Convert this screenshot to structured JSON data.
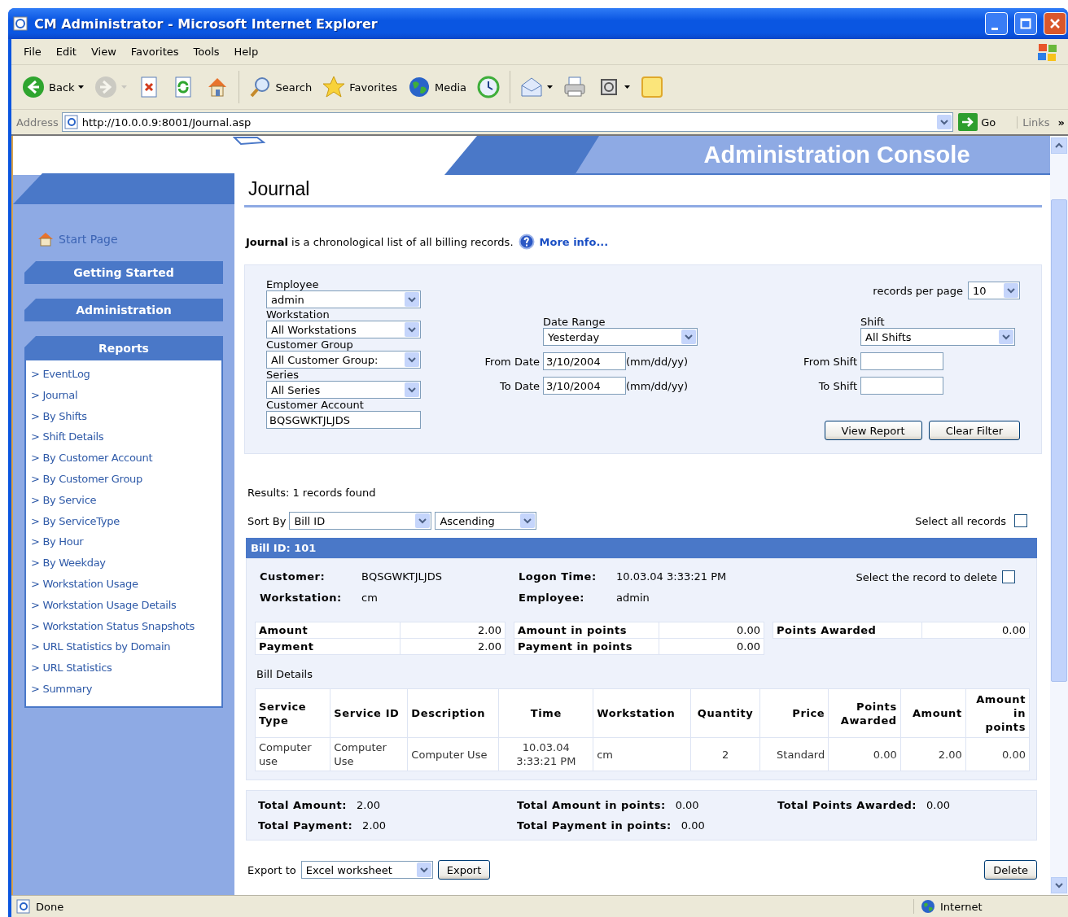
{
  "window": {
    "title": "CM Administrator - Microsoft Internet Explorer"
  },
  "menu": [
    "File",
    "Edit",
    "View",
    "Favorites",
    "Tools",
    "Help"
  ],
  "toolbar": [
    {
      "kind": "back",
      "label": "Back",
      "disabled": false,
      "has_menu": true
    },
    {
      "kind": "forward",
      "disabled": true,
      "has_menu": true
    },
    {
      "kind": "stop",
      "disabled": false,
      "has_menu": false
    },
    {
      "kind": "refresh",
      "disabled": false,
      "has_menu": false
    },
    {
      "kind": "home",
      "disabled": false,
      "has_menu": false
    },
    {
      "kind": "search",
      "label": "Search",
      "disabled": false,
      "has_menu": false
    },
    {
      "kind": "favorites",
      "label": "Favorites",
      "disabled": false,
      "has_menu": false
    },
    {
      "kind": "media",
      "label": "Media",
      "disabled": false,
      "has_menu": false
    },
    {
      "kind": "history",
      "disabled": false,
      "has_menu": false
    },
    {
      "kind": "mail",
      "disabled": false,
      "has_menu": true
    },
    {
      "kind": "print",
      "disabled": false,
      "has_menu": false
    },
    {
      "kind": "edit",
      "disabled": false,
      "has_menu": true
    },
    {
      "kind": "note",
      "disabled": false,
      "has_menu": false
    }
  ],
  "address": {
    "label": "Address",
    "url": "http://10.0.0.9:8001/Journal.asp",
    "go": "Go",
    "links": "Links",
    "more": "»"
  },
  "banner": {
    "title": "Administration Console"
  },
  "sidebar": {
    "start_page": "Start Page",
    "sections": [
      "Getting Started",
      "Administration"
    ],
    "reports": {
      "title": "Reports",
      "items": [
        "> EventLog",
        "> Journal",
        "> By Shifts",
        "> Shift Details",
        "> By Customer Account",
        "> By Customer Group",
        "> By Service",
        "> By ServiceType",
        "> By Hour",
        "> By Weekday",
        "> Workstation Usage",
        "> Workstation Usage Details",
        "> Workstation Status Snapshots",
        "> URL Statistics by Domain",
        "> URL Statistics",
        "> Summary"
      ]
    }
  },
  "page": {
    "title": "Journal",
    "intro": "**Journal** is a chronological list of all billing records.",
    "more_info": "More info..."
  },
  "filter": {
    "left": [
      {
        "label": "Employee",
        "kind": "select",
        "value": "admin"
      },
      {
        "label": "Workstation",
        "kind": "select",
        "value": "All Workstations"
      },
      {
        "label": "Customer Group",
        "kind": "select",
        "value": "All Customer Group:"
      },
      {
        "label": "Series",
        "kind": "select",
        "value": "All Series"
      },
      {
        "label": "Customer Account",
        "kind": "text",
        "value": "BQSGWKTJLJDS"
      }
    ],
    "records_per_page": {
      "label": "records per page",
      "value": "10"
    },
    "date_range": {
      "label": "Date Range",
      "value": "Yesterday"
    },
    "from_date": {
      "label": "From Date",
      "value": "3/10/2004",
      "hint": "(mm/dd/yy)"
    },
    "to_date": {
      "label": "To Date",
      "value": "3/10/2004",
      "hint": "(mm/dd/yy)"
    },
    "shift": {
      "label": "Shift",
      "value": "All Shifts"
    },
    "from_shift": {
      "label": "From Shift"
    },
    "to_shift": {
      "label": "To Shift"
    },
    "buttons": [
      "View Report",
      "Clear Filter"
    ]
  },
  "results": {
    "summary": "Results:  1 records found",
    "sort_label": "Sort By",
    "sort_field": "Bill ID",
    "sort_order": "Ascending",
    "select_all": {
      "label": "Select all records",
      "checked": false
    }
  },
  "bill": {
    "header": "Bill ID: 101",
    "info": [
      {
        "label": "Customer:",
        "value": "BQSGWKTJLJDS"
      },
      {
        "label": "Workstation:",
        "value": "cm"
      },
      {
        "label": "Logon Time:",
        "value": "10.03.04 3:33:21 PM"
      },
      {
        "label": "Employee:",
        "value": "admin"
      }
    ],
    "select_delete": {
      "label": "Select the record to delete",
      "checked": false
    },
    "summary_tables": [
      [
        {
          "label": "Amount",
          "value": "2.00"
        },
        {
          "label": "Payment",
          "value": "2.00"
        }
      ],
      [
        {
          "label": "Amount in points",
          "value": "0.00"
        },
        {
          "label": "Payment in points",
          "value": "0.00"
        }
      ],
      [
        {
          "label": "Points Awarded",
          "value": "0.00"
        }
      ]
    ],
    "details_title": "Bill Details",
    "columns": [
      "Service Type",
      "Service ID",
      "Description",
      "Time",
      "Workstation",
      "Quantity",
      "Price",
      "Points Awarded",
      "Amount",
      "Amount in points"
    ],
    "rows": [
      [
        "Computer use",
        "Computer Use",
        "Computer Use",
        "10.03.04 3:33:21 PM",
        "cm",
        "2",
        "Standard",
        "0.00",
        "2.00",
        "0.00"
      ]
    ]
  },
  "totals": [
    {
      "label": "Total Amount:",
      "value": "2.00"
    },
    {
      "label": "Total Amount in points:",
      "value": "0.00"
    },
    {
      "label": "Total Points Awarded:",
      "value": "0.00"
    },
    {
      "label": "Total Payment:",
      "value": "2.00"
    },
    {
      "label": "Total Payment in points:",
      "value": "0.00"
    }
  ],
  "export": {
    "label": "Export to",
    "value": "Excel worksheet",
    "button": "Export"
  },
  "delete_button": "Delete",
  "status": {
    "text": "Done",
    "zone": "Internet"
  }
}
